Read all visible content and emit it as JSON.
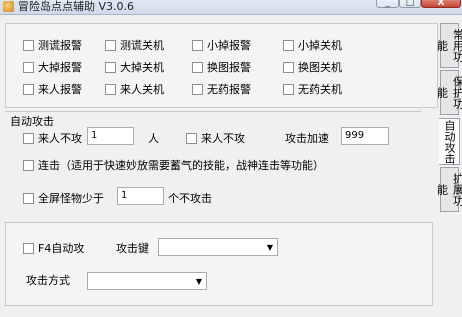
{
  "window": {
    "title": "冒险岛点点辅助 V3.0.6",
    "buttons": {
      "minimize": "_",
      "maximize": "□",
      "close": "X"
    }
  },
  "tabs": [
    {
      "label": "常用功能",
      "active": false
    },
    {
      "label": "保护功能",
      "active": false
    },
    {
      "label": "自动攻击",
      "active": true
    },
    {
      "label": "扩展功能",
      "active": false
    }
  ],
  "alarms": {
    "items": [
      "测谎报警",
      "测谎关机",
      "小掉报警",
      "小掉关机",
      "大掉报警",
      "大掉关机",
      "换图报警",
      "换图关机",
      "来人报警",
      "来人关机",
      "无药报警",
      "无药关机"
    ]
  },
  "auto_attack": {
    "group_label": "自动攻击",
    "no_attack_label": "来人不攻",
    "no_attack_value": "1",
    "person_unit": "人",
    "no_attack2_label": "来人不攻",
    "speed_label": "攻击加速",
    "speed_value": "999",
    "combo_label": "连击（适用于快速妙放需要蓄气的技能，战神连击等功能）",
    "monster_label": "全屏怪物少于",
    "monster_value": "1",
    "monster_suffix": "个不攻击"
  },
  "f4": {
    "f4_label": "F4自动攻",
    "key_label": "攻击键",
    "key_value": "",
    "mode_label": "攻击方式",
    "mode_value": "",
    "arrow": "▼"
  }
}
